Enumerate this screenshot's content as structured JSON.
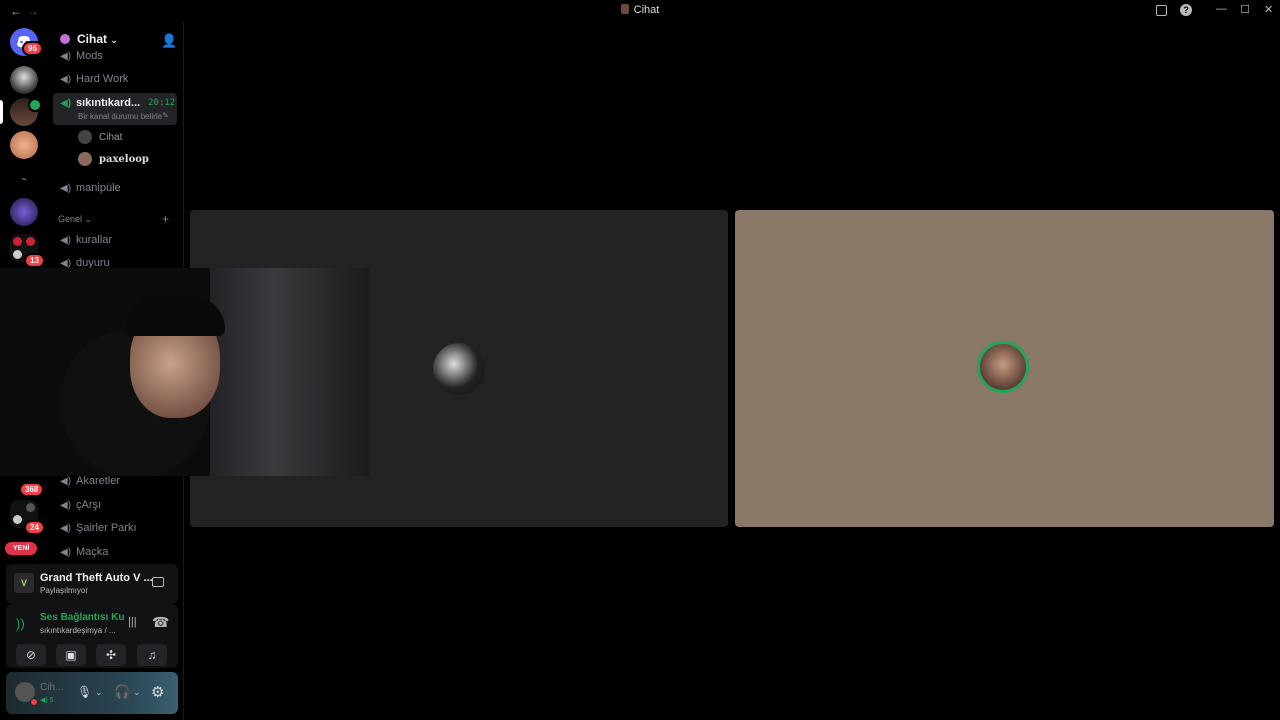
{
  "window": {
    "title": "Cihat",
    "nav_back": "←",
    "nav_forward": "→",
    "inbox_icon": "inbox-icon",
    "help_icon": "help-icon",
    "minimize": "—",
    "maximize": "☐",
    "close": "✕"
  },
  "rail": {
    "home_badge": "96",
    "servers": [
      {
        "badge": ""
      },
      {
        "badge": ""
      },
      {
        "badge": ""
      },
      {
        "badge": ""
      },
      {
        "badge": ""
      },
      {
        "badge": "13"
      }
    ],
    "lower_badges": [
      "368",
      "24"
    ],
    "new_label": "YENİ"
  },
  "sidebar": {
    "guild_name": "Cihat",
    "channels_top": [
      {
        "name": "Mods"
      },
      {
        "name": "Hard Work"
      }
    ],
    "active_channel": {
      "name": "sıkıntıkard...",
      "time": "20:12",
      "status": "Bir kanal durumu belirle"
    },
    "voice_users": [
      {
        "name": "Cihat"
      },
      {
        "name": "paxeloop"
      }
    ],
    "channel_after": "manipüle",
    "category": "Genel",
    "category_channels": [
      {
        "name": "kurallar"
      },
      {
        "name": "duyuru"
      }
    ],
    "channels_bottom": [
      {
        "name": "Akaretler"
      },
      {
        "name": "çArşı"
      },
      {
        "name": "Şairler Parkı"
      },
      {
        "name": "Maçka"
      }
    ]
  },
  "activity": {
    "game": "Grand Theft Auto V ...",
    "status": "Paylaşılmıyor"
  },
  "voice": {
    "status": "Ses Bağlantısı Ku",
    "channel": "sıkıntıkardeşimya / ..."
  },
  "user": {
    "name": "Cih...",
    "sub": "5"
  },
  "colors": {
    "accent_green": "#23a55a",
    "badge_red": "#f23f43",
    "tile_dark": "#232323",
    "tile_tan": "#8a7868"
  }
}
